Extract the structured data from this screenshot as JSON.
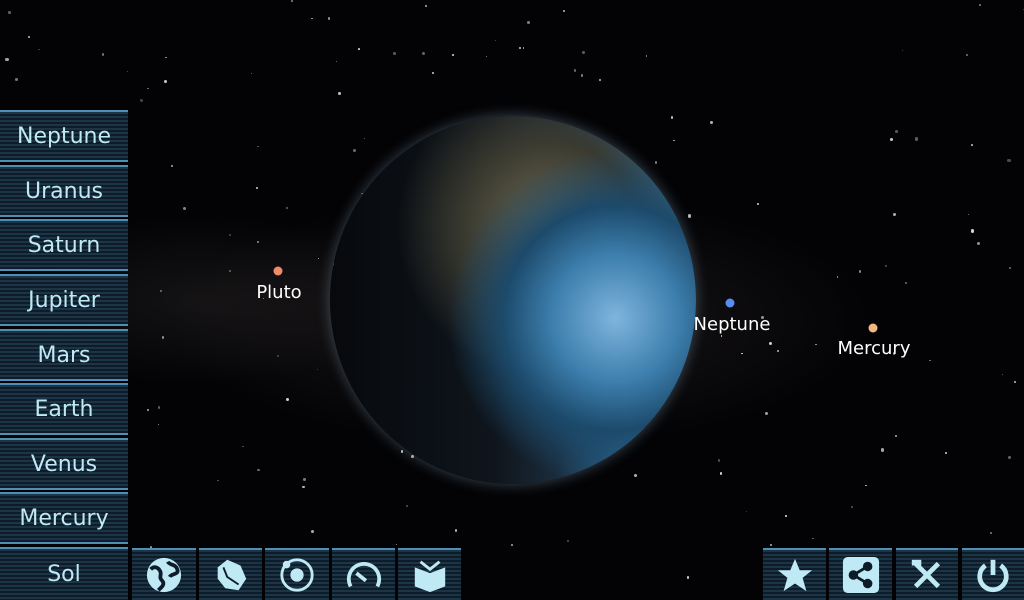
{
  "sidebar": {
    "items": [
      {
        "label": "Neptune"
      },
      {
        "label": "Uranus"
      },
      {
        "label": "Saturn"
      },
      {
        "label": "Jupiter"
      },
      {
        "label": "Mars"
      },
      {
        "label": "Earth"
      },
      {
        "label": "Venus"
      },
      {
        "label": "Mercury"
      },
      {
        "label": "Sol"
      }
    ]
  },
  "scene": {
    "focused_body": "Earth",
    "labels": [
      {
        "name": "Pluto",
        "color": "#f08a6a"
      },
      {
        "name": "Neptune",
        "color": "#5a8cf0"
      },
      {
        "name": "Mercury",
        "color": "#f0b880"
      }
    ]
  },
  "toolbar_left": [
    "globe-icon",
    "asteroid-icon",
    "orbit-icon",
    "speedometer-icon",
    "book-icon"
  ],
  "toolbar_right": [
    "star-icon",
    "share-icon",
    "tools-icon",
    "power-icon"
  ],
  "colors": {
    "accent": "#bfe9f5",
    "border": "#4f8fb5"
  }
}
